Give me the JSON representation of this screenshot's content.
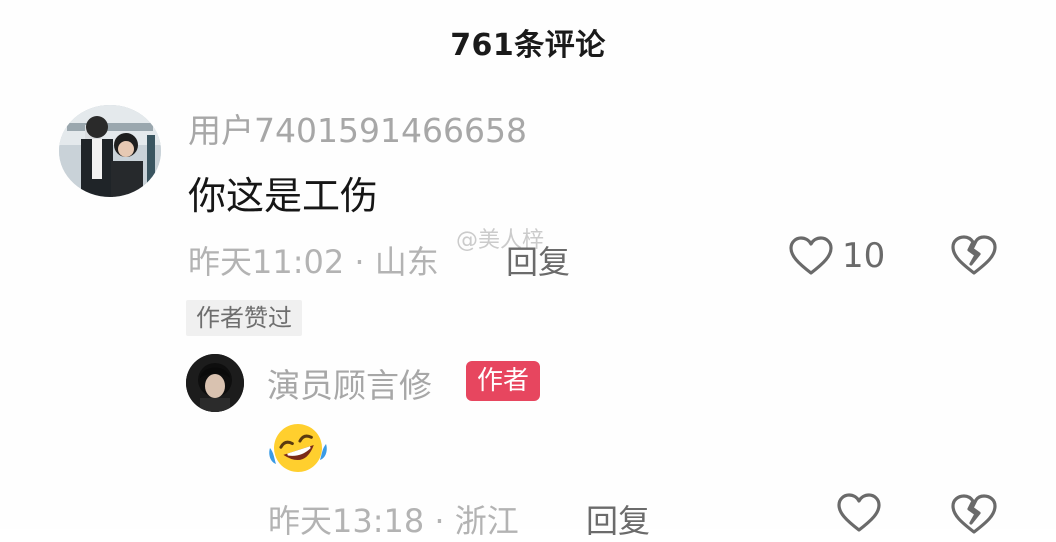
{
  "header": {
    "title": "761条评论"
  },
  "comment": {
    "username": "用户7401591466658",
    "content": "你这是工伤",
    "meta": "昨天11:02 · 山东",
    "reply_label": "回复",
    "like_count": "10",
    "author_liked_tag": "作者赞过",
    "watermark": "@美人梓"
  },
  "reply": {
    "username": "演员顾言修",
    "author_badge": "作者",
    "emoji": "laughing-crying-emoji",
    "meta": "昨天13:18 · 浙江",
    "reply_label": "回复"
  },
  "icons": {
    "like": "heart-outline",
    "dislike": "broken-heart-outline"
  },
  "colors": {
    "author_badge_bg": "#e7465f",
    "meta_text": "#b3b3b3",
    "username_text": "#a7a7a7"
  }
}
